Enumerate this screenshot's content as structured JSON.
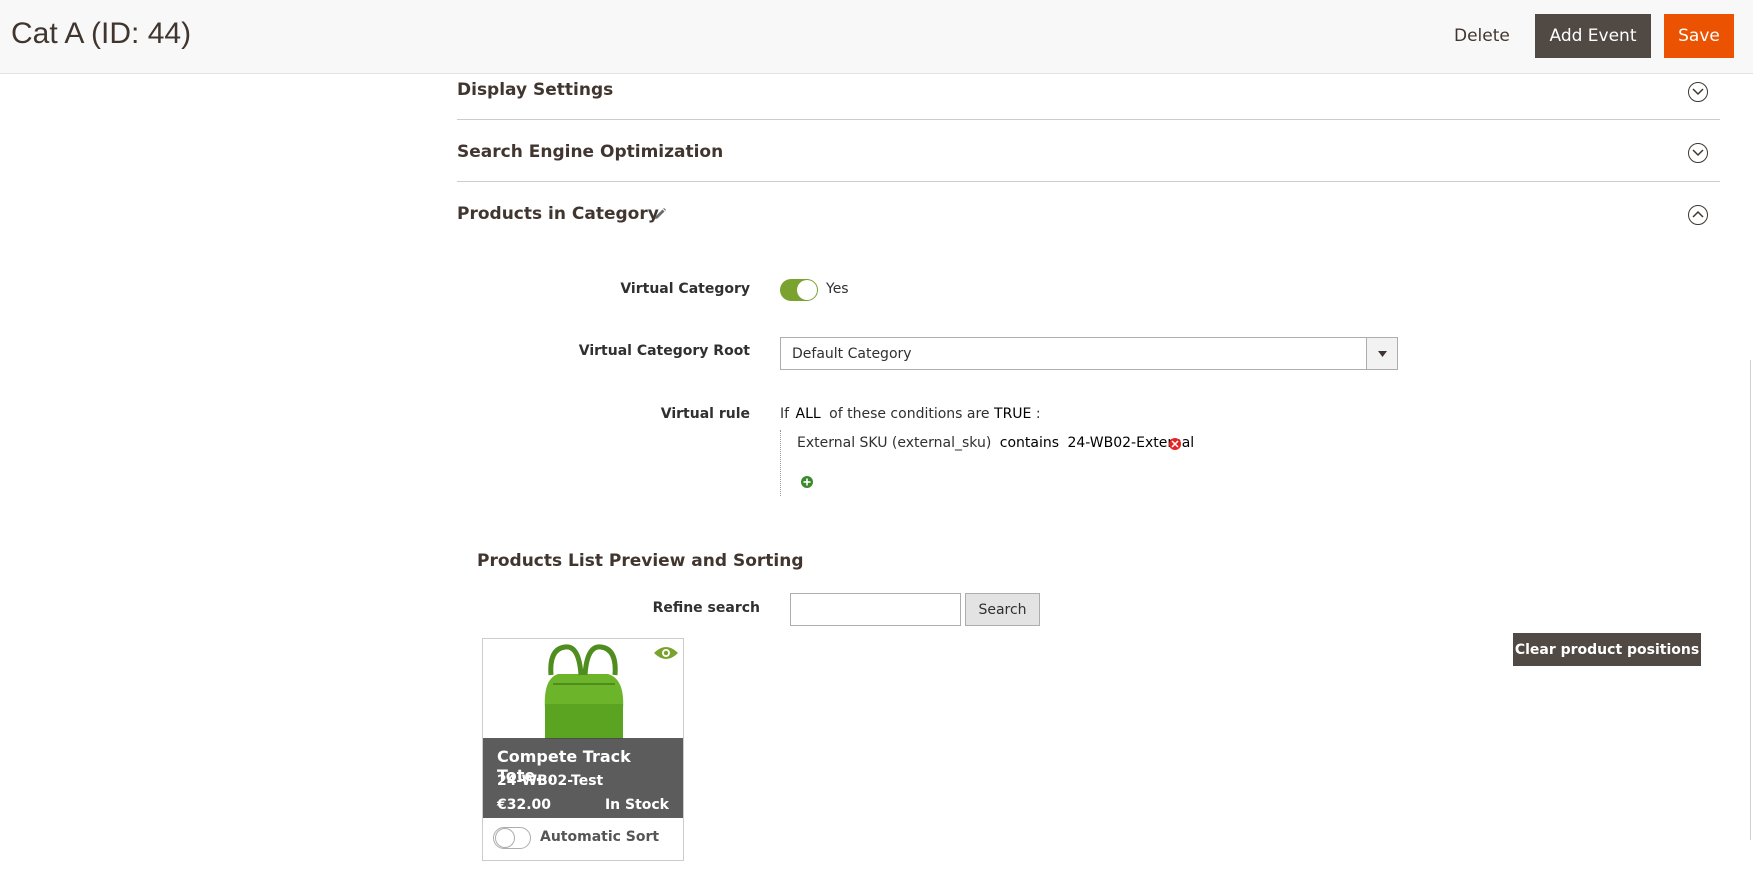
{
  "header": {
    "title": "Cat A (ID: 44)",
    "delete_label": "Delete",
    "add_event_label": "Add Event",
    "save_label": "Save"
  },
  "sections": {
    "display_settings": "Display Settings",
    "seo": "Search Engine Optimization",
    "products_in_category": "Products in Category"
  },
  "fields": {
    "virtual_category_label": "Virtual Category",
    "virtual_category_value": "Yes",
    "virtual_category_root_label": "Virtual Category Root",
    "virtual_category_root_value": "Default Category",
    "virtual_rule_label": "Virtual rule"
  },
  "rule": {
    "prefix": "If",
    "aggregator": "ALL",
    "middle": "of these conditions are",
    "value": "TRUE",
    "suffix": ":",
    "condition_attribute": "External SKU (external_sku)",
    "condition_operator": "contains",
    "condition_value": "24-WB02-External"
  },
  "preview": {
    "title": "Products List Preview and Sorting",
    "refine_label": "Refine search",
    "search_value": "",
    "search_button": "Search",
    "clear_positions_button": "Clear product positions"
  },
  "product": {
    "name": "Compete Track Tote...",
    "sku": "24-WB02-Test",
    "price": "€32.00",
    "stock": "In Stock",
    "sort_label": "Automatic Sort",
    "image_color": "#6cb52b"
  },
  "colors": {
    "accent": "#eb5202",
    "dark_button": "#514943",
    "toggle_on": "#79a22e"
  }
}
